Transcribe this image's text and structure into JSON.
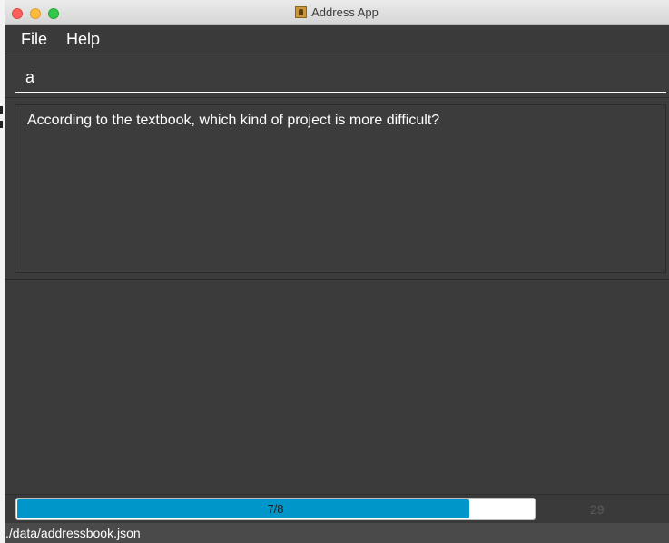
{
  "window": {
    "title": "Address App",
    "app_icon": "address-book-icon"
  },
  "menu": {
    "items": [
      {
        "label": "File"
      },
      {
        "label": "Help"
      }
    ]
  },
  "command": {
    "value": "a"
  },
  "result": {
    "text": "According to the textbook, which kind of project is more difficult?"
  },
  "progress": {
    "label": "7/8",
    "fraction": 0.875,
    "color": "#0096c9"
  },
  "counter": {
    "value": "29"
  },
  "status": {
    "file_path": "./data/addressbook.json"
  },
  "colors": {
    "window_bg": "#3c3c3c",
    "text": "#ffffff",
    "accent": "#0096c9"
  }
}
